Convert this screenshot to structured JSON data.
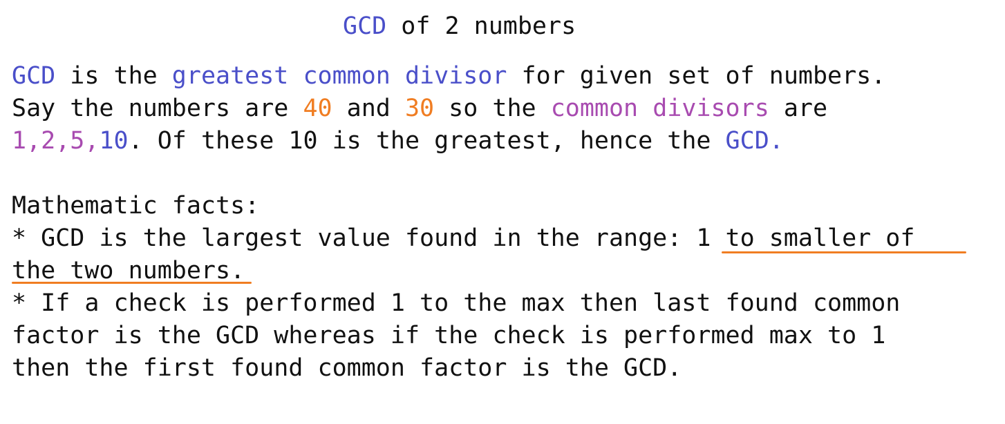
{
  "title": {
    "gcd": "GCD",
    "rest": " of 2 numbers"
  },
  "para1": {
    "l1_gcd": "GCD",
    "l1_a": " is the ",
    "l1_term": "greatest common divisor",
    "l1_b": " for given set of numbers.",
    "l2_a": "Say the numbers are ",
    "l2_n1": "40",
    "l2_b": " and ",
    "l2_n2": "30",
    "l2_c": " so the ",
    "l2_term": "common divisors",
    "l2_d": " are",
    "l3_divs": "1,2,5,",
    "l3_ten": "10",
    "l3_a": ". Of these 10 is the greatest, hence the ",
    "l3_gcd": "GCD."
  },
  "facts": {
    "heading": "Mathematic facts:",
    "f1_a": "* GCD is the largest value found in the range: ",
    "f1_b": "1 to smaller of ",
    "f1_c": "the two numbers.",
    "f2_l1": "* If a check is performed 1 to the max then last found common",
    "f2_l2": "factor is the GCD whereas if the check is performed max to 1",
    "f2_l3": "then the first found common factor is the GCD."
  },
  "colors": {
    "blue": "#4a4fc9",
    "orange": "#f07d22",
    "purple": "#a84bb0",
    "text": "#111111"
  }
}
